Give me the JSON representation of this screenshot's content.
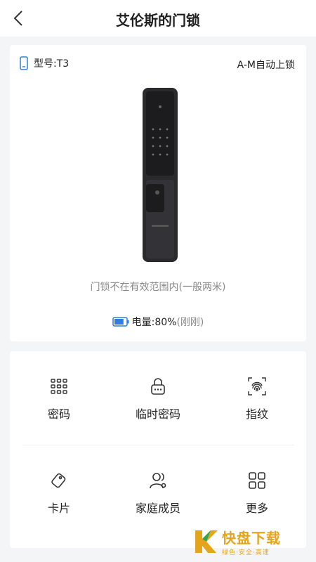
{
  "header": {
    "title": "艾伦斯的门锁"
  },
  "device": {
    "model_label": "型号:T3",
    "auto_lock": "A-M自动上锁",
    "status": "门锁不在有效范围内(一般两米)",
    "battery_label": "电量:80%",
    "battery_time": "(刚刚)",
    "battery_level": 0.8
  },
  "features": [
    {
      "label": "密码",
      "icon": "keypad-icon"
    },
    {
      "label": "临时密码",
      "icon": "temp-password-icon"
    },
    {
      "label": "指纹",
      "icon": "fingerprint-icon"
    },
    {
      "label": "卡片",
      "icon": "card-icon"
    },
    {
      "label": "家庭成员",
      "icon": "family-members-icon"
    },
    {
      "label": "更多",
      "icon": "more-grid-icon"
    }
  ],
  "watermark": {
    "main": "快盘下载",
    "sub": "绿色·安全·高速"
  },
  "colors": {
    "accent": "#2f7de1",
    "watermark": "#e4a51d"
  }
}
